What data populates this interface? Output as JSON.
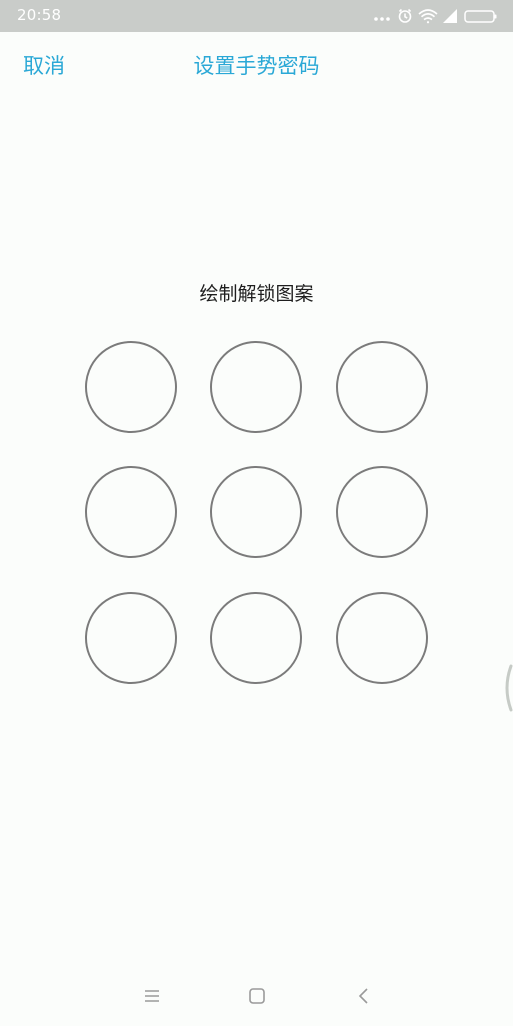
{
  "status_bar": {
    "time": "20:58",
    "icons": [
      "dots-icon",
      "alarm-icon",
      "wifi-icon",
      "signal-icon",
      "battery-icon"
    ]
  },
  "header": {
    "cancel_label": "取消",
    "title": "设置手势密码"
  },
  "main": {
    "instruction": "绘制解锁图案",
    "pattern_dots": [
      1,
      2,
      3,
      4,
      5,
      6,
      7,
      8,
      9
    ]
  },
  "nav_bar": {
    "icons": [
      "menu-icon",
      "home-icon",
      "back-icon"
    ]
  },
  "colors": {
    "accent": "#2aa8d6",
    "circle_stroke": "#7b7b7b",
    "background": "#fbfdfb",
    "status_bar": "#c9ccc9"
  }
}
